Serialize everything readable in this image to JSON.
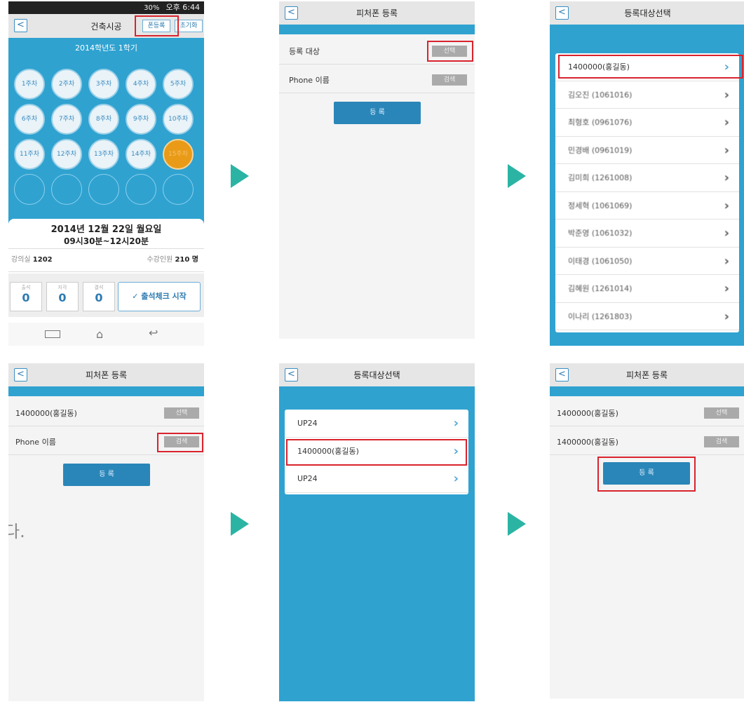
{
  "colors": {
    "accent": "#2fa2d0",
    "highlight": "#d9232d",
    "arrow": "#2bb4a4",
    "active_week": "#e99b17"
  },
  "s1": {
    "status_time": "오후 6:44",
    "status_battery": "30%",
    "title": "건축시공",
    "btn_phone_reg": "폰등록",
    "btn_reset": "초기화",
    "semester": "2014학년도 1학기",
    "weeks": [
      "1주차",
      "2주차",
      "3주차",
      "4주차",
      "5주차",
      "6주차",
      "7주차",
      "8주차",
      "9주차",
      "10주차",
      "11주차",
      "12주차",
      "13주차",
      "14주차",
      "15주차"
    ],
    "date": "2014년 12월 22일 월요일",
    "time": "09시30분~12시20분",
    "room_label": "강의실",
    "room": "1202",
    "count_label": "수강인원",
    "count": "210 명",
    "stats": [
      {
        "label": "출석",
        "value": "0"
      },
      {
        "label": "지각",
        "value": "0"
      },
      {
        "label": "결석",
        "value": "0"
      }
    ],
    "start_btn": "✓ 출석체크 시작"
  },
  "s2": {
    "title": "피처폰 등록",
    "row1": "등록 대상",
    "row1_btn": "선택",
    "row2": "Phone 이름",
    "row2_btn": "검색",
    "register": "등 록"
  },
  "s3": {
    "title": "등록대상선택",
    "items": [
      "1400000(홍길동)",
      "김오진 (1061016)",
      "최형호 (0961076)",
      "민경배 (0961019)",
      "김미희 (1261008)",
      "정세혁 (1061069)",
      "박준영 (1061032)",
      "이태경 (1061050)",
      "김혜원 (1261014)",
      "이나리 (1261803)"
    ]
  },
  "s4": {
    "title": "피처폰 등록",
    "row1": "1400000(홍길동)",
    "row1_btn": "선택",
    "row2": "Phone 이름",
    "row2_btn": "검색",
    "register": "등 록"
  },
  "s5": {
    "title": "등록대상선택",
    "items": [
      "UP24",
      "1400000(홍길동)",
      "UP24"
    ]
  },
  "s6": {
    "title": "피처폰 등록",
    "row1": "1400000(홍길동)",
    "row1_btn": "선택",
    "row2": "1400000(홍길동)",
    "row2_btn": "검색",
    "register": "등 록"
  },
  "caption": "다."
}
